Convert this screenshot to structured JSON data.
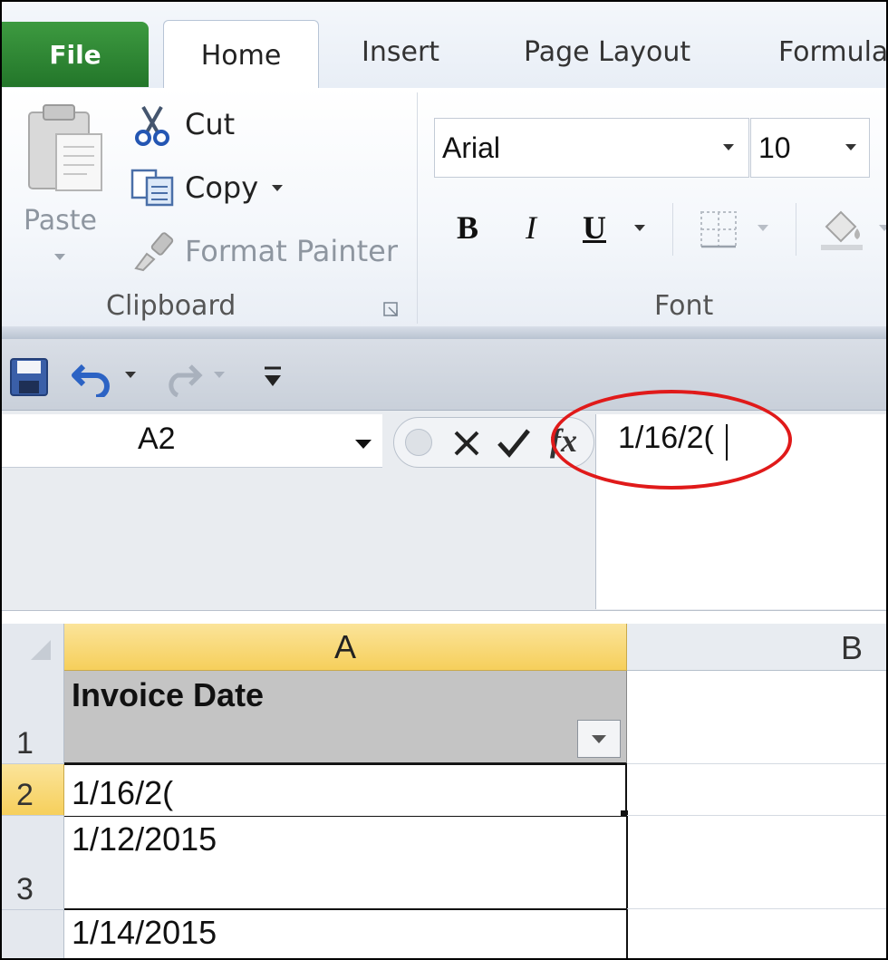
{
  "tabs": {
    "file": "File",
    "home": "Home",
    "insert": "Insert",
    "page_layout": "Page Layout",
    "formulas": "Formula"
  },
  "clipboard": {
    "paste": "Paste",
    "cut": "Cut",
    "copy": "Copy",
    "format_painter": "Format Painter",
    "group_label": "Clipboard"
  },
  "font": {
    "font_name": "Arial",
    "font_size": "10",
    "bold": "B",
    "italic": "I",
    "underline": "U",
    "group_label": "Font"
  },
  "formula_bar": {
    "name_box": "A2",
    "value": "1/16/2(",
    "fx": "fx"
  },
  "sheet": {
    "columns": [
      "A",
      "B"
    ],
    "rows": [
      {
        "num": "1",
        "a": "Invoice Date"
      },
      {
        "num": "2",
        "a": "1/16/2("
      },
      {
        "num": "3",
        "a": "1/12/2015"
      },
      {
        "num": "",
        "a": "1/14/2015"
      }
    ]
  },
  "colors": {
    "file_tab": "#2e8b34",
    "selected_header": "#f6cf5b",
    "annotation_circle": "#e01a1a"
  }
}
